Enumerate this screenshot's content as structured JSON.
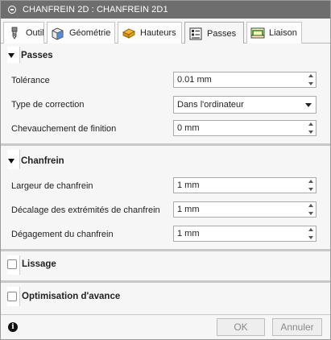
{
  "window": {
    "title": "CHANFREIN 2D : CHANFREIN 2D1"
  },
  "tabs": [
    {
      "label": "Outil",
      "icon": "tool-icon"
    },
    {
      "label": "Géométrie",
      "icon": "geometry-icon"
    },
    {
      "label": "Hauteurs",
      "icon": "heights-icon"
    },
    {
      "label": "Passes",
      "icon": "passes-icon",
      "active": true
    },
    {
      "label": "Liaison",
      "icon": "linking-icon"
    }
  ],
  "passes": {
    "title": "Passes",
    "tolerance": {
      "label": "Tolérance",
      "value": "0.01 mm"
    },
    "correction": {
      "label": "Type de correction",
      "value": "Dans l'ordinateur"
    },
    "overlap": {
      "label": "Chevauchement de finition",
      "value": "0 mm"
    }
  },
  "chamfer": {
    "title": "Chanfrein",
    "width": {
      "label": "Largeur de chanfrein",
      "value": "1 mm"
    },
    "tip_offset": {
      "label": "Décalage des extrémités de chanfrein",
      "value": "1 mm"
    },
    "clearance": {
      "label": "Dégagement du chanfrein",
      "value": "1 mm"
    }
  },
  "smoothing": {
    "title": "Lissage",
    "checked": false
  },
  "feed_optimization": {
    "title": "Optimisation d'avance",
    "checked": false
  },
  "footer": {
    "ok": "OK",
    "cancel": "Annuler"
  },
  "colors": {
    "titlebar": "#6e6e6e",
    "separator": "#c8c8c8",
    "button_text_disabled": "#8a8a8a"
  }
}
